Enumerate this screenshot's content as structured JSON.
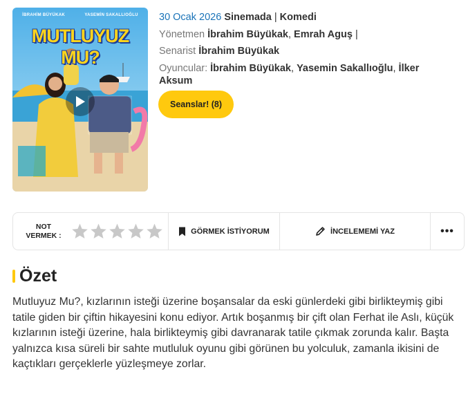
{
  "poster": {
    "title_art": "MUTLUYUZ MU?",
    "actor1_art": "İBRAHİM BÜYÜKAK",
    "actor2_art": "YASEMİN SAKALLIOĞLU",
    "play_icon": "play-icon"
  },
  "meta": {
    "date": "30 Ocak 2026",
    "release": "Sinemada",
    "separator": "|",
    "genre": "Komedi",
    "director_label": "Yönetmen",
    "directors": [
      "İbrahim Büyükak",
      "Emrah Aguş"
    ],
    "writer_label": "Senarist",
    "writer": "İbrahim Büyükak",
    "cast_label": "Oyuncular:",
    "cast": [
      "İbrahim Büyükak",
      "Yasemin Sakallıoğlu",
      "İlker Aksum"
    ]
  },
  "sessions_button": "Seanslar! (8)",
  "action_bar": {
    "rate_label_line1": "NOT",
    "rate_label_line2": "VERMEK :",
    "stars_total": 5,
    "stars_filled": 0,
    "watch_label": "GÖRMEK İSTİYORUM",
    "review_label": "İNCELEMEMİ YAZ",
    "more_label": "•••",
    "icons": [
      "bookmark-icon",
      "pencil-icon",
      "more-icon",
      "star-icon"
    ]
  },
  "summary": {
    "title": "Özet",
    "text": "Mutluyuz Mu?, kızlarının isteği üzerine boşansalar da eski günlerdeki gibi birlikteymiş gibi tatile giden bir çiftin hikayesini konu ediyor. Artık boşanmış bir çift olan Ferhat ile Aslı, küçük kızlarının isteği üzerine, hala birlikteymiş gibi davranarak tatile çıkmak zorunda kalır. Başta yalnızca kısa süreli bir sahte mutluluk oyunu gibi görünen bu yolculuk, zamanla ikisini de kaçtıkları gerçeklerle yüzleşmeye zorlar."
  },
  "colors": {
    "accent_yellow": "#ffc90e",
    "date_blue": "#1a73b8",
    "star_gray": "#c8c8c8"
  }
}
